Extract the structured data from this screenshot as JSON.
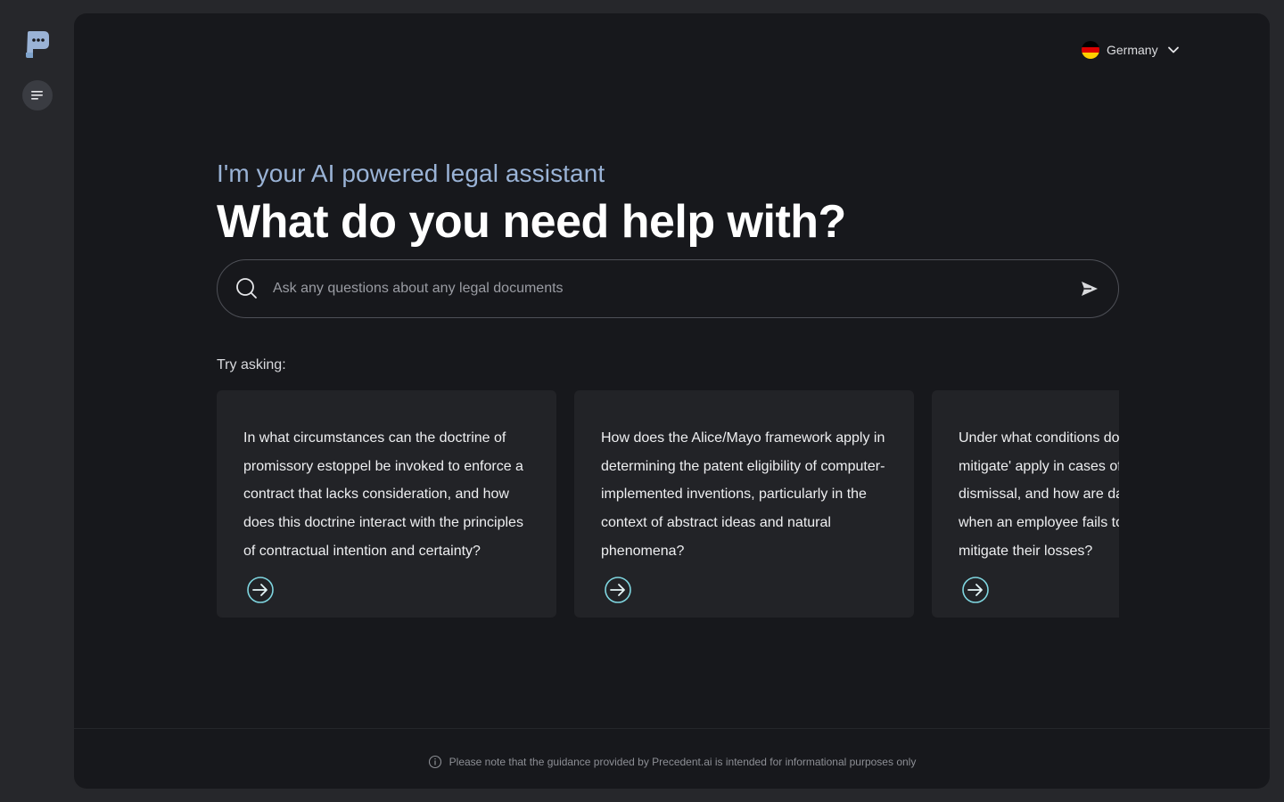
{
  "sidebar": {
    "logo_icon": "precedent-logo-icon",
    "menu_icon": "history-menu-icon"
  },
  "header": {
    "country": "Germany",
    "flag_colors": [
      "#000000",
      "#dd0000",
      "#ffce00"
    ]
  },
  "hero": {
    "subtitle": "I'm your AI powered legal assistant",
    "title": "What do you need help with?"
  },
  "search": {
    "placeholder": "Ask any questions about any legal documents",
    "value": ""
  },
  "suggestions": {
    "label": "Try asking:",
    "items": [
      {
        "text": "In what circumstances can the doctrine of promissory estoppel be invoked to enforce a contract that lacks consideration, and how does this doctrine interact with the principles of contractual intention and certainty?"
      },
      {
        "text": "How does the Alice/Mayo framework apply in determining the patent eligibility of computer-implemented inventions, particularly in the context of abstract ideas and natural phenomena?"
      },
      {
        "text": "Under what conditions does the 'duty to mitigate' apply in cases of wrongful dismissal, and how are damages calculated when an employee fails to reasonably mitigate their losses?"
      }
    ]
  },
  "footer": {
    "notice": "Please note that the guidance provided by Precedent.ai is intended for informational purposes only"
  },
  "colors": {
    "accent": "#9ab3d6",
    "arrow": "#7fd6e0",
    "background": "#17181c",
    "card": "#222327"
  }
}
